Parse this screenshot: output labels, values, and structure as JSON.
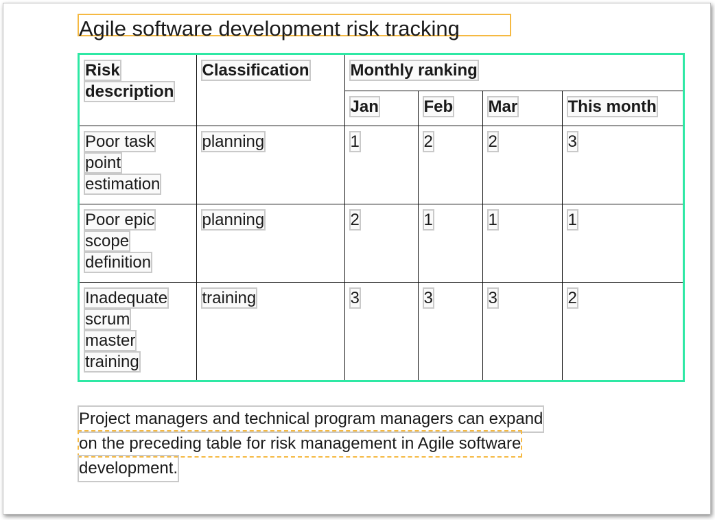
{
  "document": {
    "title": "Agile software development risk tracking",
    "table": {
      "header": {
        "risk_description": [
          "Risk",
          "description"
        ],
        "classification": "Classification",
        "monthly_ranking": "Monthly ranking",
        "months": [
          "Jan",
          "Feb",
          "Mar",
          "This month"
        ]
      },
      "rows": [
        {
          "description": [
            "Poor task",
            "point",
            "estimation"
          ],
          "classification": "planning",
          "rankings": [
            "1",
            "2",
            "2",
            "3"
          ]
        },
        {
          "description": [
            "Poor epic",
            "scope",
            "definition"
          ],
          "classification": "planning",
          "rankings": [
            "2",
            "1",
            "1",
            "1"
          ]
        },
        {
          "description": [
            "Inadequate",
            "scrum",
            "master",
            "training"
          ],
          "classification": "training",
          "rankings": [
            "3",
            "3",
            "3",
            "2"
          ]
        }
      ]
    },
    "paragraph": [
      "Project managers and technical program managers can expand",
      "on the preceding table for risk management in Agile software",
      "development."
    ]
  }
}
